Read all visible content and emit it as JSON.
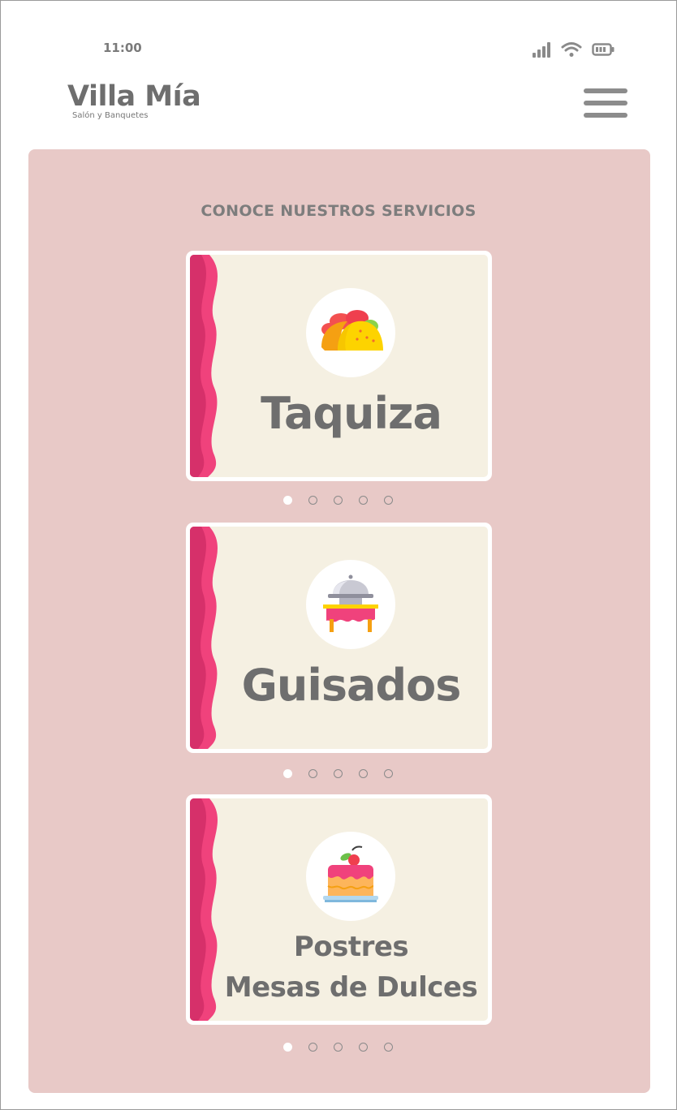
{
  "status_bar": {
    "time": "11:00",
    "icons": [
      "cellular-signal-icon",
      "wifi-icon",
      "battery-icon"
    ]
  },
  "header": {
    "brand_name": "Villa Mía",
    "brand_tagline": "Salón y Banquetes",
    "menu_icon": "hamburger-menu-icon"
  },
  "section": {
    "title": "CONOCE NUESTROS SERVICIOS"
  },
  "cards": [
    {
      "title": "Taquiza",
      "icon": "taco-icon",
      "carousel_dots": 5,
      "active_dot": 1
    },
    {
      "title": "Guisados",
      "icon": "buffet-dish-icon",
      "carousel_dots": 5,
      "active_dot": 1
    },
    {
      "title_line1": "Postres",
      "title_line2": "Mesas de Dulces",
      "icon": "cake-icon",
      "carousel_dots": 5,
      "active_dot": 1
    }
  ],
  "colors": {
    "panel": "#e8c9c7",
    "card": "#f5f0e2",
    "accent_pink": "#f0427c",
    "accent_pink_dark": "#d6306a",
    "text_gray": "#6e6e6e"
  }
}
